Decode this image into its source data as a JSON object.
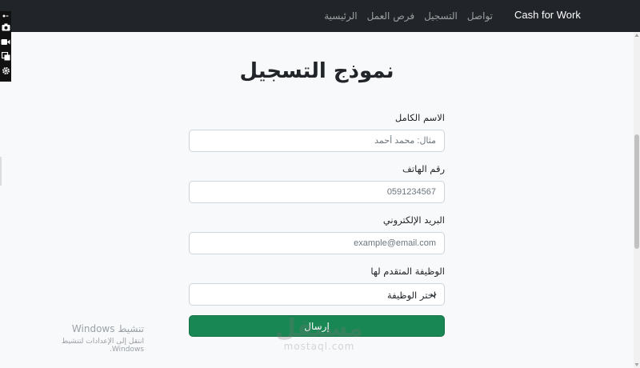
{
  "navbar": {
    "brand": "Cash for Work",
    "links": [
      "الرئيسية",
      "فرص العمل",
      "التسجيل",
      "تواصل"
    ]
  },
  "toolbar": {
    "icons": [
      "extension-icon",
      "camera-icon",
      "video-icon",
      "windows-icon",
      "gear-icon"
    ]
  },
  "form": {
    "title": "نموذج التسجيل",
    "fields": [
      {
        "label": "الاسم الكامل",
        "placeholder": "مثال: محمد أحمد"
      },
      {
        "label": "رقم الهاتف",
        "placeholder": "0591234567"
      },
      {
        "label": "البريد الإلكتروني",
        "placeholder": "example@email.com"
      }
    ],
    "job_label": "الوظيفة المتقدم لها",
    "job_selected": "اختر الوظيفة",
    "submit_label": "إرسال"
  },
  "windows_activation": {
    "title": "تنشيط Windows",
    "subtitle": "انتقل إلى الإعدادات لتنشيط Windows."
  },
  "site_watermark": {
    "arabic": "مستقل",
    "latin": "mostaql.com"
  },
  "colors": {
    "navbar_bg": "#212529",
    "submit_bg": "#198754",
    "page_bg": "#f8f9fa"
  }
}
